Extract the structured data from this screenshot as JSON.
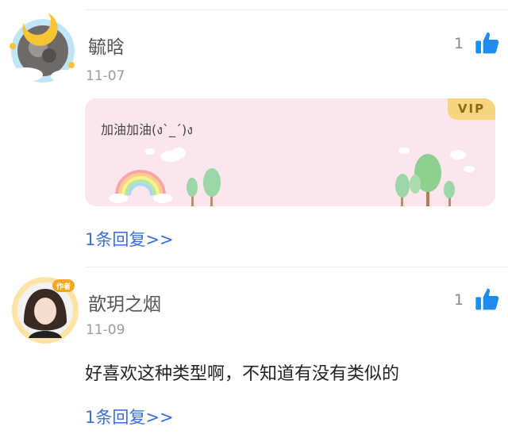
{
  "comments": [
    {
      "username": "毓晗",
      "date": "11-07",
      "likes": "1",
      "vip_badge": "VIP",
      "text": "加油加油(ง`_´)ง",
      "reply_link": "1条回复>>"
    },
    {
      "username": "歆玥之烟",
      "date": "11-09",
      "likes": "1",
      "avatar_badge": "作者",
      "text": "好喜欢这种类型啊，不知道有没有类似的",
      "reply_link": "1条回复>>"
    }
  ],
  "colors": {
    "like_blue": "#1e8cf0",
    "reply_blue": "#3c6fd6",
    "vip_card_bg": "#fce6ee",
    "vip_badge_bg": "#f5d57e"
  },
  "icons": [
    "like-thumb-icon",
    "moon-avatar-frame",
    "rainbow-icon",
    "tree-icon",
    "cloud-icon"
  ]
}
